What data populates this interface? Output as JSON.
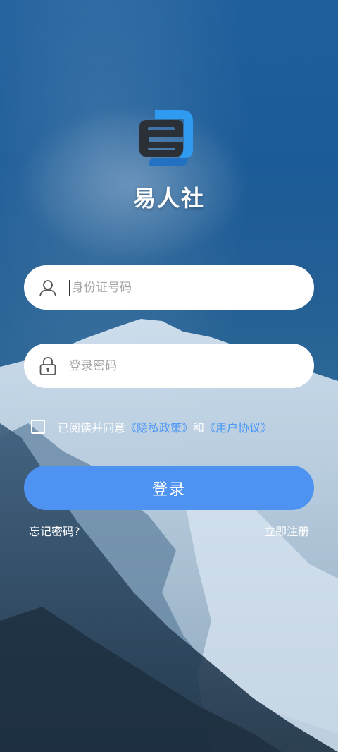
{
  "app": {
    "name": "易人社"
  },
  "login_form": {
    "id_field": {
      "placeholder": "身份证号码",
      "value": ""
    },
    "password_field": {
      "placeholder": "登录密码",
      "value": ""
    },
    "agreement": {
      "checked": false,
      "prefix": "已阅读并同意",
      "privacy_link": "《隐私政策》",
      "conjunction": "和",
      "user_link": "《用户协议》"
    },
    "submit_label": "登录",
    "forgot_label": "忘记密码?",
    "register_label": "立即注册"
  },
  "icons": {
    "id_field": "user-icon",
    "password_field": "lock-icon"
  },
  "colors": {
    "primary_button": "#4f93f2",
    "link": "#4c97f5"
  }
}
